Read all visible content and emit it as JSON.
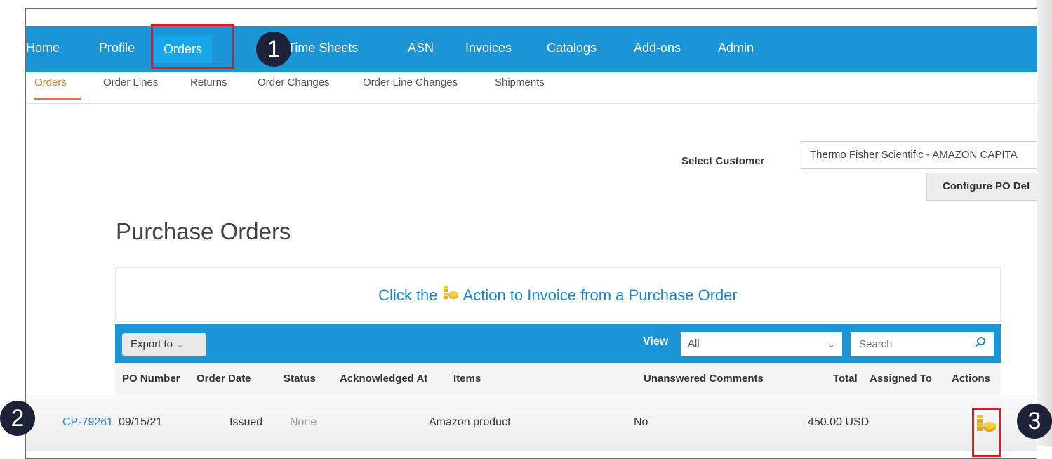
{
  "nav": {
    "items": [
      {
        "label": "Home"
      },
      {
        "label": "Profile"
      },
      {
        "label": "Orders"
      },
      {
        "label": "/Time Sheets"
      },
      {
        "label": "ASN"
      },
      {
        "label": "Invoices"
      },
      {
        "label": "Catalogs"
      },
      {
        "label": "Add-ons"
      },
      {
        "label": "Admin"
      }
    ]
  },
  "subnav": {
    "items": [
      {
        "label": "Orders"
      },
      {
        "label": "Order Lines"
      },
      {
        "label": "Returns"
      },
      {
        "label": "Order Changes"
      },
      {
        "label": "Order Line Changes"
      },
      {
        "label": "Shipments"
      }
    ]
  },
  "customer": {
    "label": "Select Customer",
    "value": "Thermo Fisher Scientific - AMAZON CAPITA"
  },
  "configure_button": "Configure PO Del",
  "page_title": "Purchase Orders",
  "banner": {
    "before": "Click the",
    "after": "Action to Invoice from a Purchase Order",
    "icon": "coins-icon"
  },
  "toolbar": {
    "export_label": "Export to",
    "view_label": "View",
    "view_value": "All",
    "search_placeholder": "Search"
  },
  "table": {
    "columns": [
      "PO Number",
      "Order Date",
      "Status",
      "Acknowledged At",
      "Items",
      "Unanswered Comments",
      "Total",
      "Assigned To",
      "Actions"
    ],
    "rows": [
      {
        "po_number": "CP-79261",
        "order_date": "09/15/21",
        "status": "Issued",
        "acknowledged_at": "None",
        "items": "Amazon product",
        "unanswered_comments": "No",
        "total": "450.00 USD",
        "assigned_to": "",
        "action_icon": "invoice-coins-icon"
      }
    ]
  },
  "callouts": [
    "1",
    "2",
    "3"
  ],
  "colors": {
    "nav_blue": "#1b95d6",
    "active_tab": "#17a6e9",
    "link_blue": "#1a86c8",
    "sub_active": "#e5752c",
    "highlight_red": "#e8151b",
    "badge": "#1d2238"
  }
}
